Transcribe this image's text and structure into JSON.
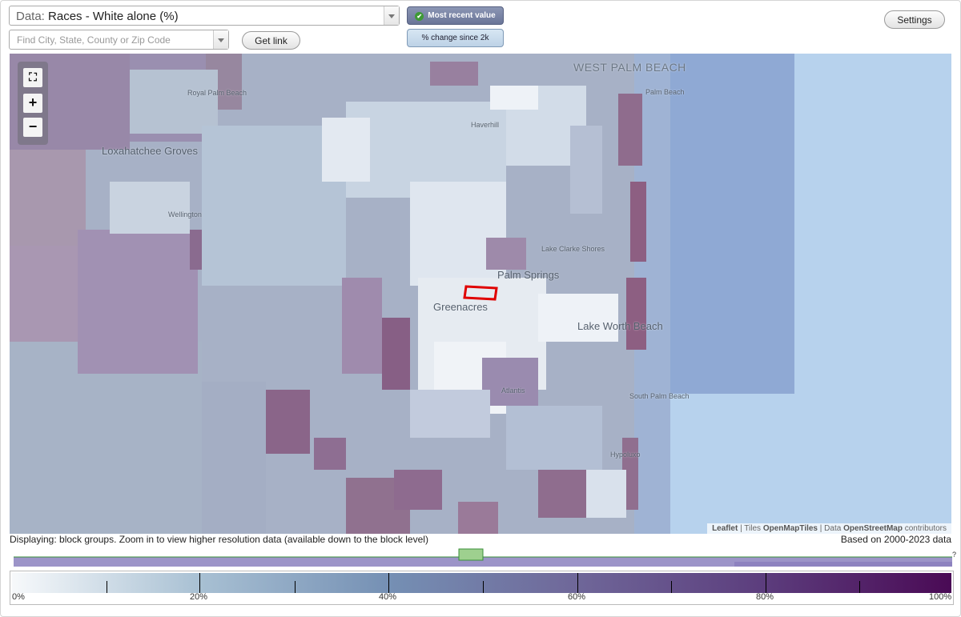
{
  "controls": {
    "data_prefix": "Data:",
    "data_value": "Races - White alone (%)",
    "search_placeholder": "Find City, State, County or Zip Code",
    "get_link": "Get link",
    "mode_recent": "Most recent value",
    "mode_change": "% change since 2k",
    "settings": "Settings"
  },
  "map": {
    "places": {
      "west_palm_beach": "WEST PALM BEACH",
      "royal_palm_beach": "Royal Palm Beach",
      "palm_beach": "Palm Beach",
      "haverhill": "Haverhill",
      "loxahatchee_groves": "Loxahatchee Groves",
      "wellington": "Wellington",
      "lake_clarke_shores": "Lake Clarke Shores",
      "palm_springs": "Palm Springs",
      "greenacres": "Greenacres",
      "lake_worth_beach": "Lake Worth Beach",
      "atlantis": "Atlantis",
      "south_palm_beach": "South Palm Beach",
      "hypoluxo": "Hypoluxo"
    },
    "attribution": {
      "leaflet": "Leaflet",
      "tiles_pre": "Tiles",
      "tiles": "OpenMapTiles",
      "data_pre": "Data",
      "osm": "OpenStreetMap",
      "contrib": "contributors"
    }
  },
  "footer": {
    "displaying": "Displaying: block groups. Zoom in to view higher resolution data (available down to the block level)",
    "based_on": "Based on 2000-2023 data",
    "help": "?"
  },
  "legend": {
    "labels": [
      "0%",
      "20%",
      "40%",
      "60%",
      "80%",
      "100%"
    ],
    "colors": [
      "#f7f9fb",
      "#a8c0d3",
      "#7590b4",
      "#6f6799",
      "#5c3d7d",
      "#4a0a55"
    ]
  }
}
